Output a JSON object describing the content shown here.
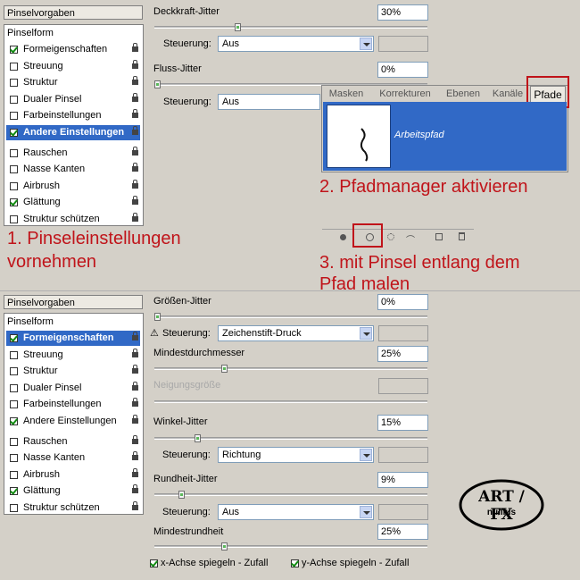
{
  "panel_top": {
    "header": "Pinselvorgaben",
    "list_title": "Pinselform",
    "items": [
      {
        "label": "Formeigenschaften",
        "checked": true,
        "selected": false
      },
      {
        "label": "Streuung",
        "checked": false,
        "selected": false
      },
      {
        "label": "Struktur",
        "checked": false,
        "selected": false
      },
      {
        "label": "Dualer Pinsel",
        "checked": false,
        "selected": false
      },
      {
        "label": "Farbeinstellungen",
        "checked": false,
        "selected": false
      },
      {
        "label": "Andere Einstellungen",
        "checked": true,
        "selected": true
      },
      {
        "label": "Rauschen",
        "checked": false,
        "selected": false
      },
      {
        "label": "Nasse Kanten",
        "checked": false,
        "selected": false
      },
      {
        "label": "Airbrush",
        "checked": false,
        "selected": false
      },
      {
        "label": "Glättung",
        "checked": true,
        "selected": false
      },
      {
        "label": "Struktur schützen",
        "checked": false,
        "selected": false
      }
    ],
    "deckkraft_label": "Deckkraft-Jitter",
    "deckkraft_value": "30%",
    "deckkraft_level": 0.3,
    "steuerung1_label": "Steuerung:",
    "steuerung1_value": "Aus",
    "fluss_label": "Fluss-Jitter",
    "fluss_value": "0%",
    "fluss_level": 0,
    "steuerung2_label": "Steuerung:",
    "steuerung2_value": "Aus"
  },
  "paths_panel": {
    "tabs": [
      "Masken",
      "Korrekturen",
      "Ebenen",
      "Kanäle",
      "Pfade"
    ],
    "path_name": "Arbeitspfad"
  },
  "annotations": {
    "step1_line1": "1. Pinseleinstellungen",
    "step1_line2": "vornehmen",
    "step2": "2. Pfadmanager aktivieren",
    "step3_line1": "3. mit Pinsel entlang dem",
    "step3_line2": "Pfad malen"
  },
  "panel_bottom": {
    "header": "Pinselvorgaben",
    "list_title": "Pinselform",
    "items": [
      {
        "label": "Formeigenschaften",
        "checked": true,
        "selected": true
      },
      {
        "label": "Streuung",
        "checked": false,
        "selected": false
      },
      {
        "label": "Struktur",
        "checked": false,
        "selected": false
      },
      {
        "label": "Dualer Pinsel",
        "checked": false,
        "selected": false
      },
      {
        "label": "Farbeinstellungen",
        "checked": false,
        "selected": false
      },
      {
        "label": "Andere Einstellungen",
        "checked": true,
        "selected": false
      },
      {
        "label": "Rauschen",
        "checked": false,
        "selected": false
      },
      {
        "label": "Nasse Kanten",
        "checked": false,
        "selected": false
      },
      {
        "label": "Airbrush",
        "checked": false,
        "selected": false
      },
      {
        "label": "Glättung",
        "checked": true,
        "selected": false
      },
      {
        "label": "Struktur schützen",
        "checked": false,
        "selected": false
      }
    ],
    "groessen_label": "Größen-Jitter",
    "groessen_value": "0%",
    "groessen_level": 0,
    "steuerung_a_label": "Steuerung:",
    "steuerung_a_value": "Zeichenstift-Druck",
    "mindest_label": "Mindestdurchmesser",
    "mindest_value": "25%",
    "mindest_level": 0.25,
    "neigung_label": "Neigungsgröße",
    "winkel_label": "Winkel-Jitter",
    "winkel_value": "15%",
    "winkel_level": 0.15,
    "steuerung_b_label": "Steuerung:",
    "steuerung_b_value": "Richtung",
    "rundheit_label": "Rundheit-Jitter",
    "rundheit_value": "9%",
    "rundheit_level": 0.09,
    "steuerung_c_label": "Steuerung:",
    "steuerung_c_value": "Aus",
    "mindestrund_label": "Mindestrundheit",
    "mindestrund_value": "25%",
    "mindestrund_level": 0.25,
    "x_flip_label": "x-Achse spiegeln - Zufall",
    "y_flip_label": "y-Achse spiegeln - Zufall"
  },
  "logo": {
    "line1": "ART / FX",
    "line2": "nullius"
  }
}
